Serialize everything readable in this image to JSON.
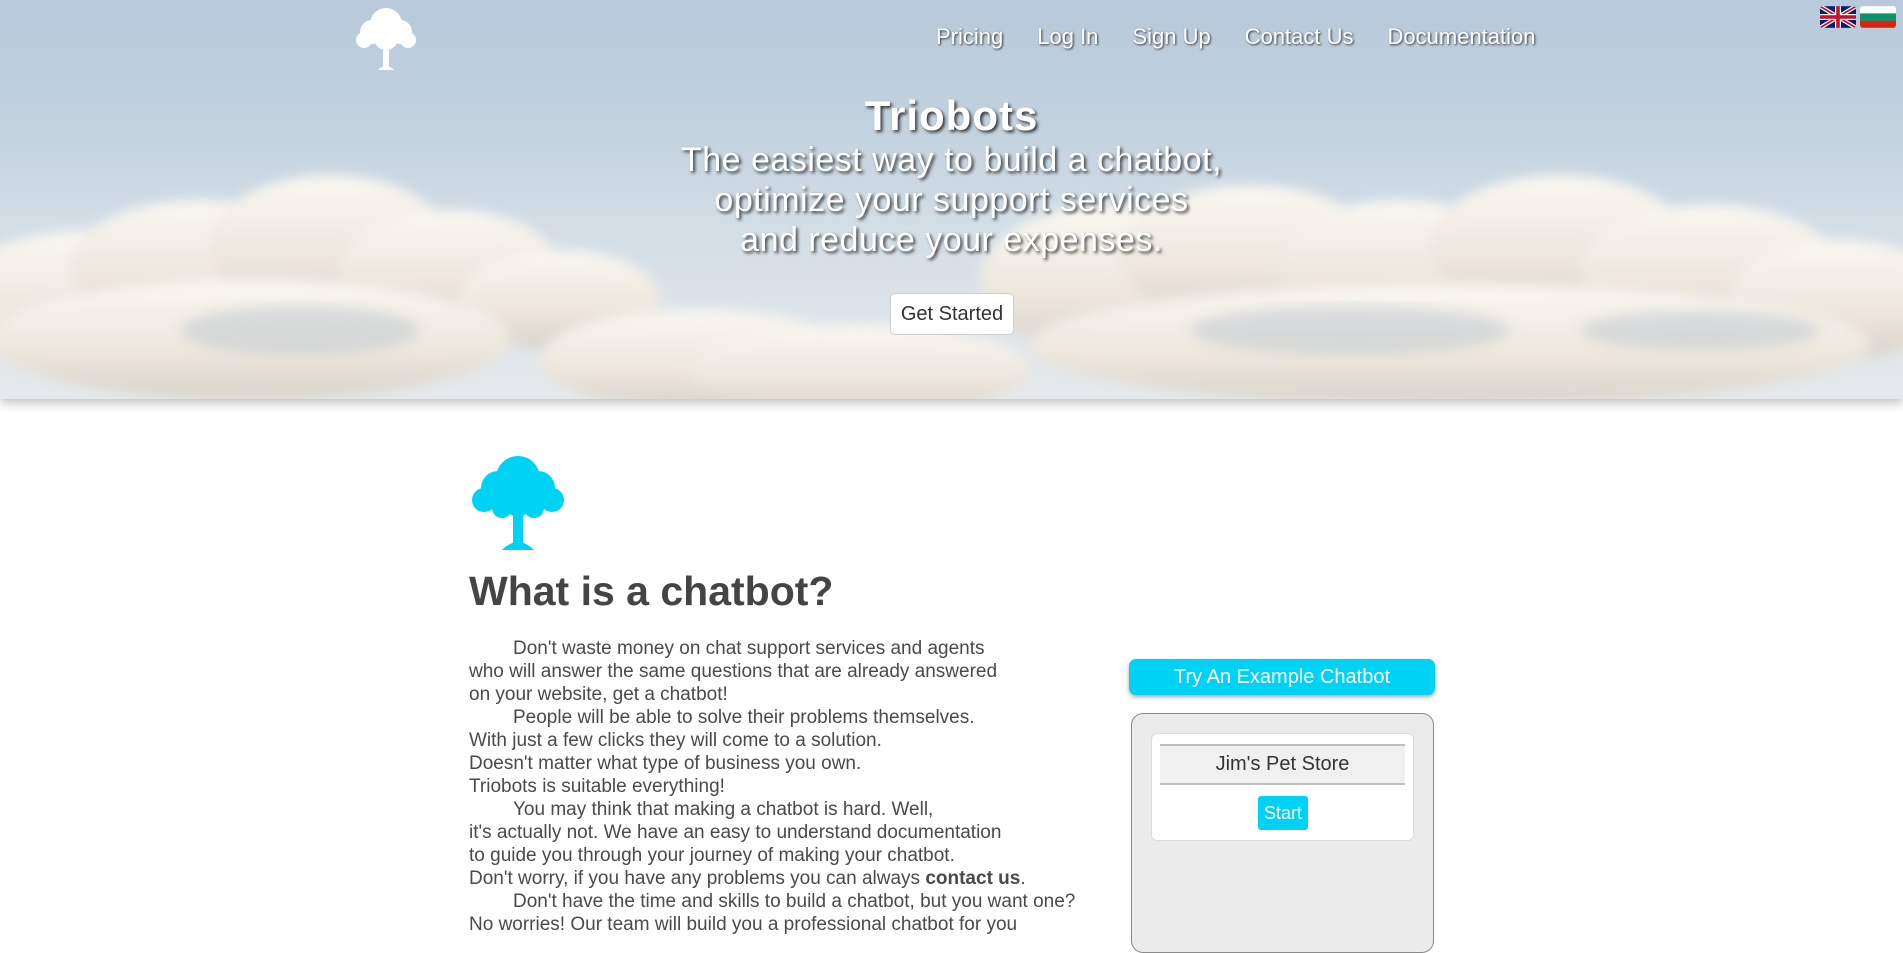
{
  "nav": {
    "items": [
      {
        "label": "Pricing"
      },
      {
        "label": "Log In"
      },
      {
        "label": "Sign Up"
      },
      {
        "label": "Contact Us"
      },
      {
        "label": "Documentation"
      }
    ]
  },
  "languages": [
    {
      "icon": "uk-flag-icon"
    },
    {
      "icon": "bulgarian-flag-icon"
    }
  ],
  "hero": {
    "title": "Triobots",
    "tagline_lines": [
      "The easiest way to build a chatbot,",
      "optimize your support services",
      "and reduce your expenses."
    ],
    "cta_label": "Get Started"
  },
  "about": {
    "title": "What is a chatbot?",
    "paragraphs": [
      {
        "indent": true,
        "text": "Don't waste money on chat support services and agents"
      },
      {
        "indent": false,
        "text": "who will answer the same questions that are already answered"
      },
      {
        "indent": false,
        "text": "on your website, get a chatbot!"
      },
      {
        "indent": true,
        "text": "People will be able to solve their problems themselves."
      },
      {
        "indent": false,
        "text": "With just a few clicks they will come to a solution."
      },
      {
        "indent": false,
        "text": "Doesn't matter what type of business you own."
      },
      {
        "indent": false,
        "text": "Triobots is suitable everything!"
      },
      {
        "indent": true,
        "text": "You may think that making a chatbot is hard. Well,"
      },
      {
        "indent": false,
        "text": "it's actually not. We have an easy to understand documentation"
      },
      {
        "indent": false,
        "text": "to guide you through your journey of making your chatbot."
      },
      {
        "indent": true,
        "text": "Don't have the time and skills to build a chatbot, but you want one?"
      },
      {
        "indent": false,
        "text": "No worries! Our team will build you a professional chatbot for you"
      }
    ],
    "worry_prefix": "Don't worry, if you have any problems you can always ",
    "contact_link": "contact us",
    "worry_suffix": "."
  },
  "demo": {
    "try_label": "Try An Example Chatbot",
    "store_name": "Jim's Pet Store",
    "start_label": "Start"
  },
  "colors": {
    "accent": "#00d2f6",
    "text": "#4a4a4a",
    "heading": "#444444"
  }
}
